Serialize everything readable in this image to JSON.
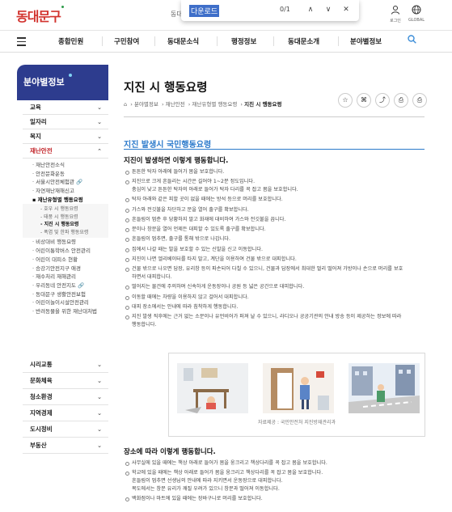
{
  "header": {
    "logo_text": "동대문구",
    "top_cut_text": "동대",
    "login_label": "로그인",
    "global_label": "GLOBAL"
  },
  "findbar": {
    "query": "다운로드",
    "count": "0/1",
    "prev_label": "∧",
    "next_label": "∨",
    "close_label": "✕"
  },
  "nav": {
    "items": [
      "종합민원",
      "구민참여",
      "동대문소식",
      "행정정보",
      "동대문소개",
      "분야별정보"
    ]
  },
  "sidebar": {
    "title": "분야별정보",
    "categories_top": [
      {
        "label": "교육",
        "chevron": "⌄"
      },
      {
        "label": "일자리",
        "chevron": "⌄"
      },
      {
        "label": "복지",
        "chevron": "⌄"
      },
      {
        "label": "재난안전",
        "chevron": "⌃"
      }
    ],
    "subs_a": [
      "· 재난안전소식",
      "· 안전문화운동",
      "· 서울시안전체험관 🔗",
      "· 자연재난재해신고"
    ],
    "sub_on": "▪ 재난유형별 행동요령",
    "subs3": [
      "- 호우 시 행동요령",
      "- 태풍 시 행동요령",
      "- 지진 시 행동요령",
      "- 폭염 및 한파 행동요령"
    ],
    "subs_b": [
      "· 비상대비 행동요령",
      "· 어린이통학버스 안전관리",
      "· 어린이 대피소 현황",
      "· 승강기안전지구 애경",
      "· 재수처리 재해관리",
      "· 우리동네 안전지도 🔗",
      "· 동대문구 생활안전보험",
      "· 어린이놀이시설안전관리",
      "· 반려동물을 위한 재난대처법"
    ],
    "categories_bottom": [
      "시리교통",
      "문화체육",
      "청소환경",
      "지역경제",
      "도시정비",
      "부동산"
    ]
  },
  "main": {
    "title": "지진 시 행동요령",
    "breadcrumb": [
      "분야별정보",
      "재난안전",
      "재난유형별 행동요령",
      "지진 시 행동요령"
    ],
    "actions": [
      "☆",
      "⌘",
      "⤴",
      "⎙",
      "⎙"
    ],
    "section_title": "지진 발생시 국민행동요령",
    "sub_title": "지진이 발생하면 이렇게 행동합니다.",
    "items": [
      [
        "튼튼한 탁자 아래에 들어가 몸을 보호합니다."
      ],
      [
        "지진으로 크게 흔들리는 시간은 길어야 1~2분 정도입니다.",
        "충심이 낮고 튼튼한 탁자의 아래로 들어가 탁자 다리를 꼭 잡고 몸을 보호합니다."
      ],
      [
        "탁자 아래와 같은 피할 곳이 없을 때에는 방석 등으로 머리를 보호합니다."
      ],
      [
        "가스와 전깃불을 차단하고 문을 열어 출구를 확보합니다."
      ],
      [
        "흔들림이 멈춘 후 당황하지 말고 화재에 대비하여 가스와 전깃불을 끕니다."
      ],
      [
        "문이나 창문을 열어 언제든 대피할 수 있도록 출구를 확보합니다."
      ],
      [
        "흔들림이 멈추면, 출구를 통해 밖으로 나갑니다."
      ],
      [
        "집에서 나갈 때는 발을 보호할 수 있는 신발을 신고 이동합니다."
      ],
      [
        "지진이 나면 엘리베이터를 타지 말고, 계단을 이용하여 건물 밖으로 대피합니다."
      ],
      [
        "건물 밖으로 나오면 담장, 유리창 등이 파손되어 다칠 수 있으니, 건물과 담장에서 최대한 멀리 떨어져 가방이나 손으로 머리를 보호",
        "하면서 대피합니다."
      ],
      [
        "떨어지는 물건에 주의하며 신속하게 운동장이나 공원 등 넓은 공간으로 대피합니다."
      ],
      [
        "이동할 때에는 차량을 이용하지 않고 걸어서 대피합니다."
      ],
      [
        "대피 장소에서는 안내에 따라 침착하게 행동합니다."
      ],
      [
        "지진 발생 직후에는 근거 없는 소문이나 유언비어가 퍼져 날 수 있으니, 라디오나 공공기관의 안내 방송 등이 제공하는 정보에 따라",
        "행동합니다."
      ]
    ],
    "illustration_caption": "자료제공 : 국민안전처 지진방재관리과",
    "sub_title2": "장소에 따라 이렇게 행동합니다.",
    "items2": [
      [
        "사무실에 있을 때에는 책상 아래로 들어가 몸을 웅크리고 책상다리를 꼭 잡고 몸을 보호합니다."
      ],
      [
        "학교에 있을 때에는 책상 아래로 들어가 몸을 웅크리고 책상다리를 꼭 잡고 몸을 보호합니다.",
        "흔들림이 멈추면 선생님의 안내에 따라 지키면서 운동장으로 대피합니다.",
        "복도에서는 창문 유리가 깨질 우려가 있으니 창문과 떨어져 이동합니다."
      ],
      [
        "백화점이나 마트에 있을 때에는 장바구니로 머리를 보호합니다."
      ]
    ]
  }
}
